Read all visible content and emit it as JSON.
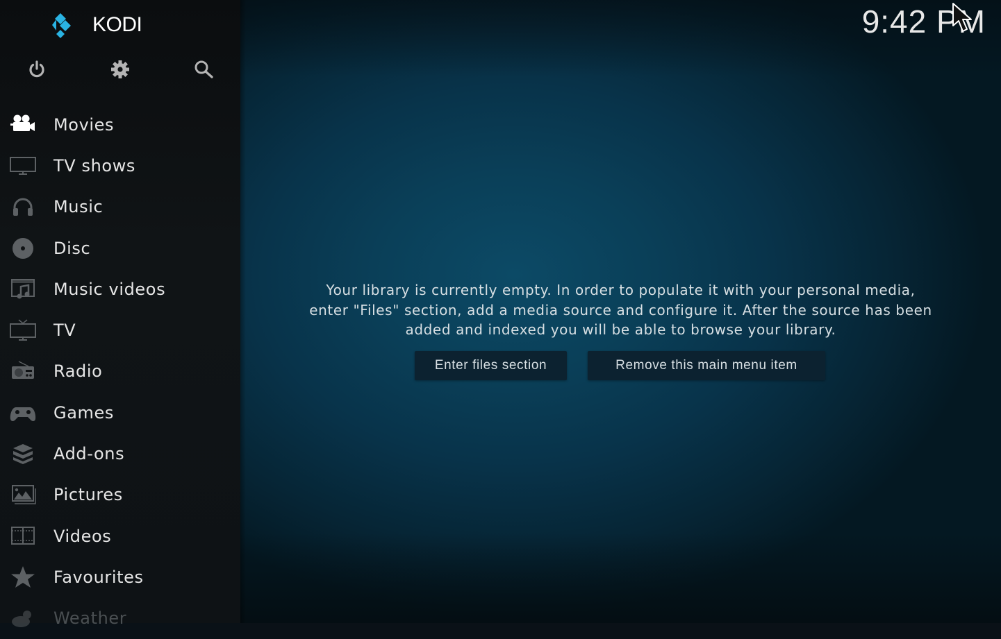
{
  "app": {
    "name": "KODI",
    "accent_color": "#2ab3e3"
  },
  "header": {
    "clock": "9:42 PM",
    "top_icons": [
      {
        "name": "power-icon",
        "label": "Power"
      },
      {
        "name": "gear-icon",
        "label": "Settings"
      },
      {
        "name": "search-icon",
        "label": "Search"
      }
    ]
  },
  "sidebar": {
    "items": [
      {
        "label": "Movies",
        "icon": "movie-camera-icon",
        "selected": true
      },
      {
        "label": "TV shows",
        "icon": "monitor-icon"
      },
      {
        "label": "Music",
        "icon": "headphones-icon"
      },
      {
        "label": "Disc",
        "icon": "disc-icon"
      },
      {
        "label": "Music videos",
        "icon": "music-video-icon"
      },
      {
        "label": "TV",
        "icon": "tv-icon"
      },
      {
        "label": "Radio",
        "icon": "radio-icon"
      },
      {
        "label": "Games",
        "icon": "gamepad-icon"
      },
      {
        "label": "Add-ons",
        "icon": "addons-box-icon"
      },
      {
        "label": "Pictures",
        "icon": "pictures-icon"
      },
      {
        "label": "Videos",
        "icon": "film-strip-icon"
      },
      {
        "label": "Favourites",
        "icon": "star-icon"
      },
      {
        "label": "Weather",
        "icon": "weather-icon"
      }
    ]
  },
  "main": {
    "message_lines": [
      "Your library is currently empty. In order to populate it with your personal media,",
      "enter \"Files\" section, add a media source and configure it. After the source has been",
      "added and indexed you will be able to browse your library."
    ],
    "buttons": {
      "enter_files": "Enter files section",
      "remove_item": "Remove this main menu item"
    }
  }
}
